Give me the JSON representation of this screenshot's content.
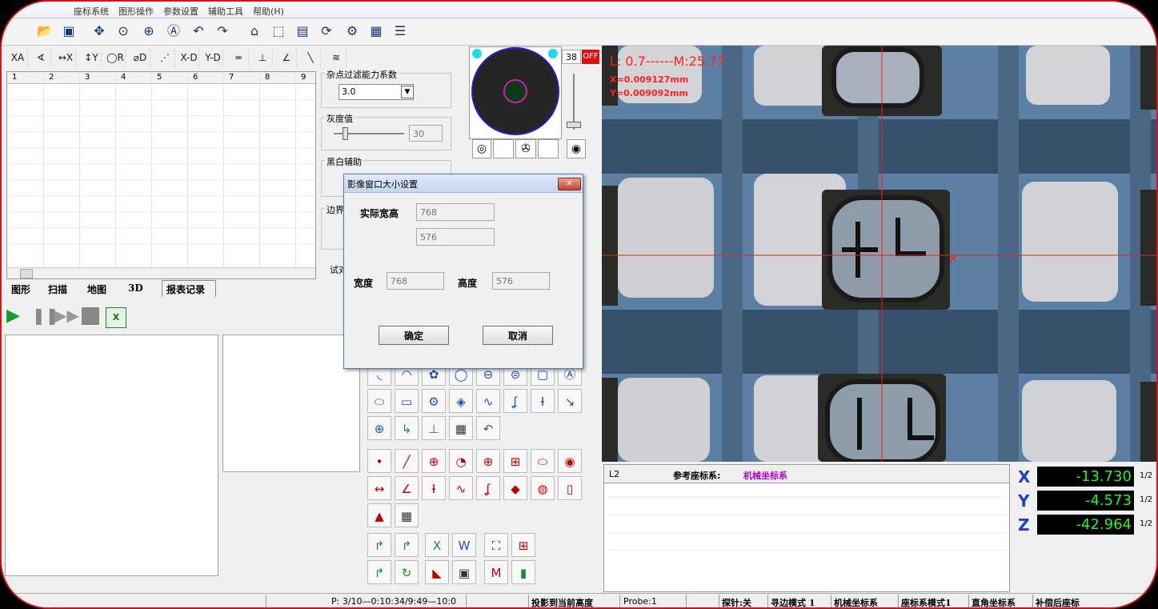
{
  "menu": [
    "座标系统",
    "图形操作",
    "参数设置",
    "辅助工具",
    "帮助(H)"
  ],
  "grid": {
    "columns": [
      "1",
      "2",
      "3",
      "4",
      "5",
      "6",
      "7",
      "8",
      "9"
    ]
  },
  "tabs": [
    "图形",
    "扫描",
    "地图",
    "3D",
    "报表记录"
  ],
  "filter_panel": {
    "noise_label": "杂点过滤能力系数",
    "noise_value": "3.0",
    "gray_label": "灰度值",
    "gray_value": "30",
    "bw_label": "黑白辅助",
    "edge_label": "边界",
    "trial_label": "试对"
  },
  "light": {
    "value": "38",
    "state": "OFF"
  },
  "camera": {
    "overlay_line1": "L: 0.7------M:25.77",
    "overlay_x": "X=0.009127mm",
    "overlay_y": "Y=0.009092mm"
  },
  "dialog": {
    "title": "影像窗口大小设置",
    "actual_label": "实际宽高",
    "actual_w": "768",
    "actual_h": "576",
    "width_label": "宽度",
    "width_value": "768",
    "height_label": "高度",
    "height_value": "576",
    "ok": "确定",
    "cancel": "取消"
  },
  "info": {
    "line": "L2",
    "ref_label": "参考座标系:",
    "ref_value": "机械坐标系"
  },
  "dro": {
    "x_label": "X",
    "x": "-13.730",
    "y_label": "Y",
    "y": "-4.573",
    "z_label": "Z",
    "z": "-42.964",
    "half": "1/2"
  },
  "status": {
    "p": "P: 3/10—0:10:34/9:49—10:0",
    "proj": "投影到当前高度",
    "probe": "Probe:1",
    "probe_state": "探针:关",
    "edge": "寻边模式 1",
    "mach": "机械坐标系",
    "coordmode": "座标系模式1",
    "rect": "直角坐标系",
    "comp": "补偿后座标"
  },
  "colors": {
    "accent": "#d0161b",
    "dro_text": "#2bef2b",
    "axis": "#1f3fd0",
    "overlay": "#ff2020"
  }
}
